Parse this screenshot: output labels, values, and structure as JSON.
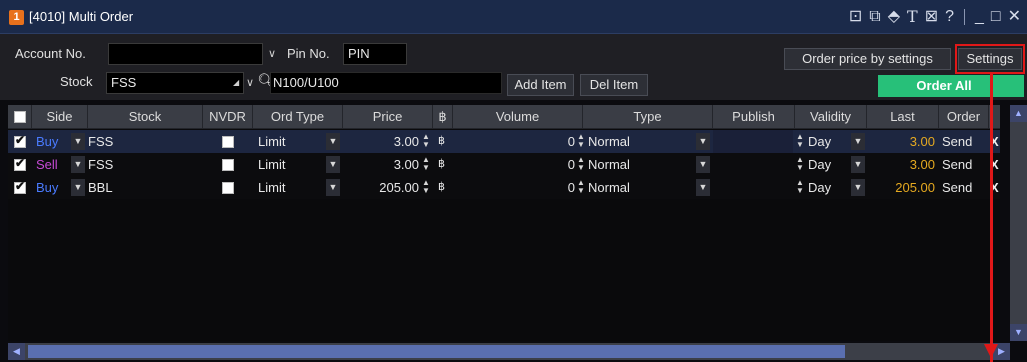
{
  "window": {
    "badge": "1",
    "title": "[4010] Multi Order",
    "icons": [
      "pin-window-icon",
      "copy-window-icon",
      "tag-icon",
      "text-icon",
      "help-box-icon",
      "help-icon",
      "minimize-icon",
      "maximize-icon",
      "close-icon"
    ],
    "icon_glyphs": [
      "⊡",
      "⧉",
      "⬘",
      "T",
      "⊠",
      "?",
      "_",
      "□",
      "✕"
    ]
  },
  "controls": {
    "account_label": "Account No.",
    "account_value": "",
    "pin_label": "Pin No.",
    "pin_placeholder": "PIN",
    "stock_label": "Stock",
    "stock_value": "FSS",
    "search_value": "N100/U100",
    "add_item": "Add Item",
    "del_item": "Del Item",
    "order_price_by_settings": "Order price by settings",
    "settings": "Settings",
    "order_all": "Order All"
  },
  "grid": {
    "headers": {
      "side": "Side",
      "stock": "Stock",
      "nvdr": "NVDR",
      "ord_type": "Ord Type",
      "price": "Price",
      "baht": "฿",
      "volume": "Volume",
      "type": "Type",
      "publish": "Publish",
      "validity": "Validity",
      "last": "Last",
      "order": "Order"
    },
    "rows": [
      {
        "checked": true,
        "side": "Buy",
        "stock": "FSS",
        "nvdr": false,
        "ord_type": "Limit",
        "price": "3.00",
        "baht": "฿",
        "volume": "0",
        "type": "Normal",
        "publish": "",
        "validity": "Day",
        "last": "3.00",
        "order": "Send",
        "remove": "X"
      },
      {
        "checked": true,
        "side": "Sell",
        "stock": "FSS",
        "nvdr": false,
        "ord_type": "Limit",
        "price": "3.00",
        "baht": "฿",
        "volume": "0",
        "type": "Normal",
        "publish": "",
        "validity": "Day",
        "last": "3.00",
        "order": "Send",
        "remove": "X"
      },
      {
        "checked": true,
        "side": "Buy",
        "stock": "BBL",
        "nvdr": false,
        "ord_type": "Limit",
        "price": "205.00",
        "baht": "฿",
        "volume": "0",
        "type": "Normal",
        "publish": "",
        "validity": "Day",
        "last": "205.00",
        "order": "Send",
        "remove": "X"
      }
    ]
  },
  "colors": {
    "buy": "#4a7bff",
    "sell": "#c64ad6",
    "last": "#e5a920",
    "order_all": "#27c079",
    "highlight": "#e01818"
  }
}
